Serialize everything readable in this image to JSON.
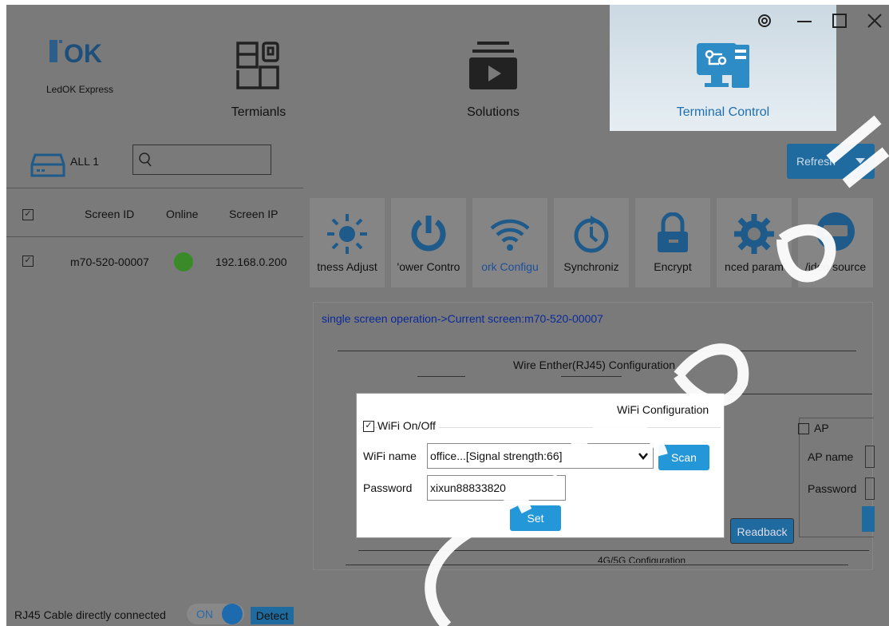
{
  "window": {
    "settings_icon": "gear-icon",
    "minimize_icon": "minimize-icon",
    "maximize_icon": "maximize-icon",
    "close_icon": "close-icon"
  },
  "brand": {
    "logo_text": "OK",
    "name": "LedOK Express"
  },
  "nav": [
    {
      "label": "Termianls",
      "icon": "terminals-icon",
      "active": false
    },
    {
      "label": "Solutions",
      "icon": "solutions-icon",
      "active": false
    },
    {
      "label": "Terminal Control",
      "icon": "terminal-control-icon",
      "active": true
    }
  ],
  "left": {
    "all_label": "ALL 1",
    "search_placeholder": "",
    "columns": [
      "Screen ID",
      "Online",
      "Screen IP"
    ],
    "rows": [
      {
        "checked": true,
        "screen_id": "m70-520-00007",
        "online": true,
        "ip": "192.168.0.200"
      }
    ]
  },
  "toolbar": {
    "refresh_label": "Refresh",
    "tools": [
      {
        "label": "tness Adjust",
        "icon": "brightness-icon"
      },
      {
        "label": "'ower Contro",
        "icon": "power-icon"
      },
      {
        "label": "ork Configu",
        "icon": "wifi-icon",
        "active": true
      },
      {
        "label": "Synchroniz",
        "icon": "clock-sync-icon"
      },
      {
        "label": "Encrypt",
        "icon": "lock-icon"
      },
      {
        "label": "nced param",
        "icon": "gear-icon"
      },
      {
        "label": "/ideo source",
        "icon": "hdmi-icon"
      }
    ]
  },
  "content": {
    "breadcrumb": "single screen operation->Current screen:m70-520-00007",
    "wire_title": "Wire Enther(RJ45) Configuration",
    "readback_label": "Readback",
    "io_title": "4G/5G Configuration",
    "ap": {
      "label": "AP",
      "name_label": "AP name",
      "password_label": "Password"
    }
  },
  "wifi_dialog": {
    "title": "WiFi Configuration",
    "toggle_label": "WiFi On/Off",
    "toggle_checked": true,
    "name_label": "WiFi name",
    "name_value": "office...[Signal strength:66]",
    "scan_label": "Scan",
    "password_label": "Password",
    "password_value": "xixun88833820",
    "set_label": "Set"
  },
  "status": {
    "text": "RJ45 Cable directly connected",
    "switch_label": "ON",
    "detect_label": "Detect"
  },
  "colors": {
    "accent": "#2497d8",
    "overlay": "#7a7a7a",
    "online": "#3a9a2e"
  }
}
